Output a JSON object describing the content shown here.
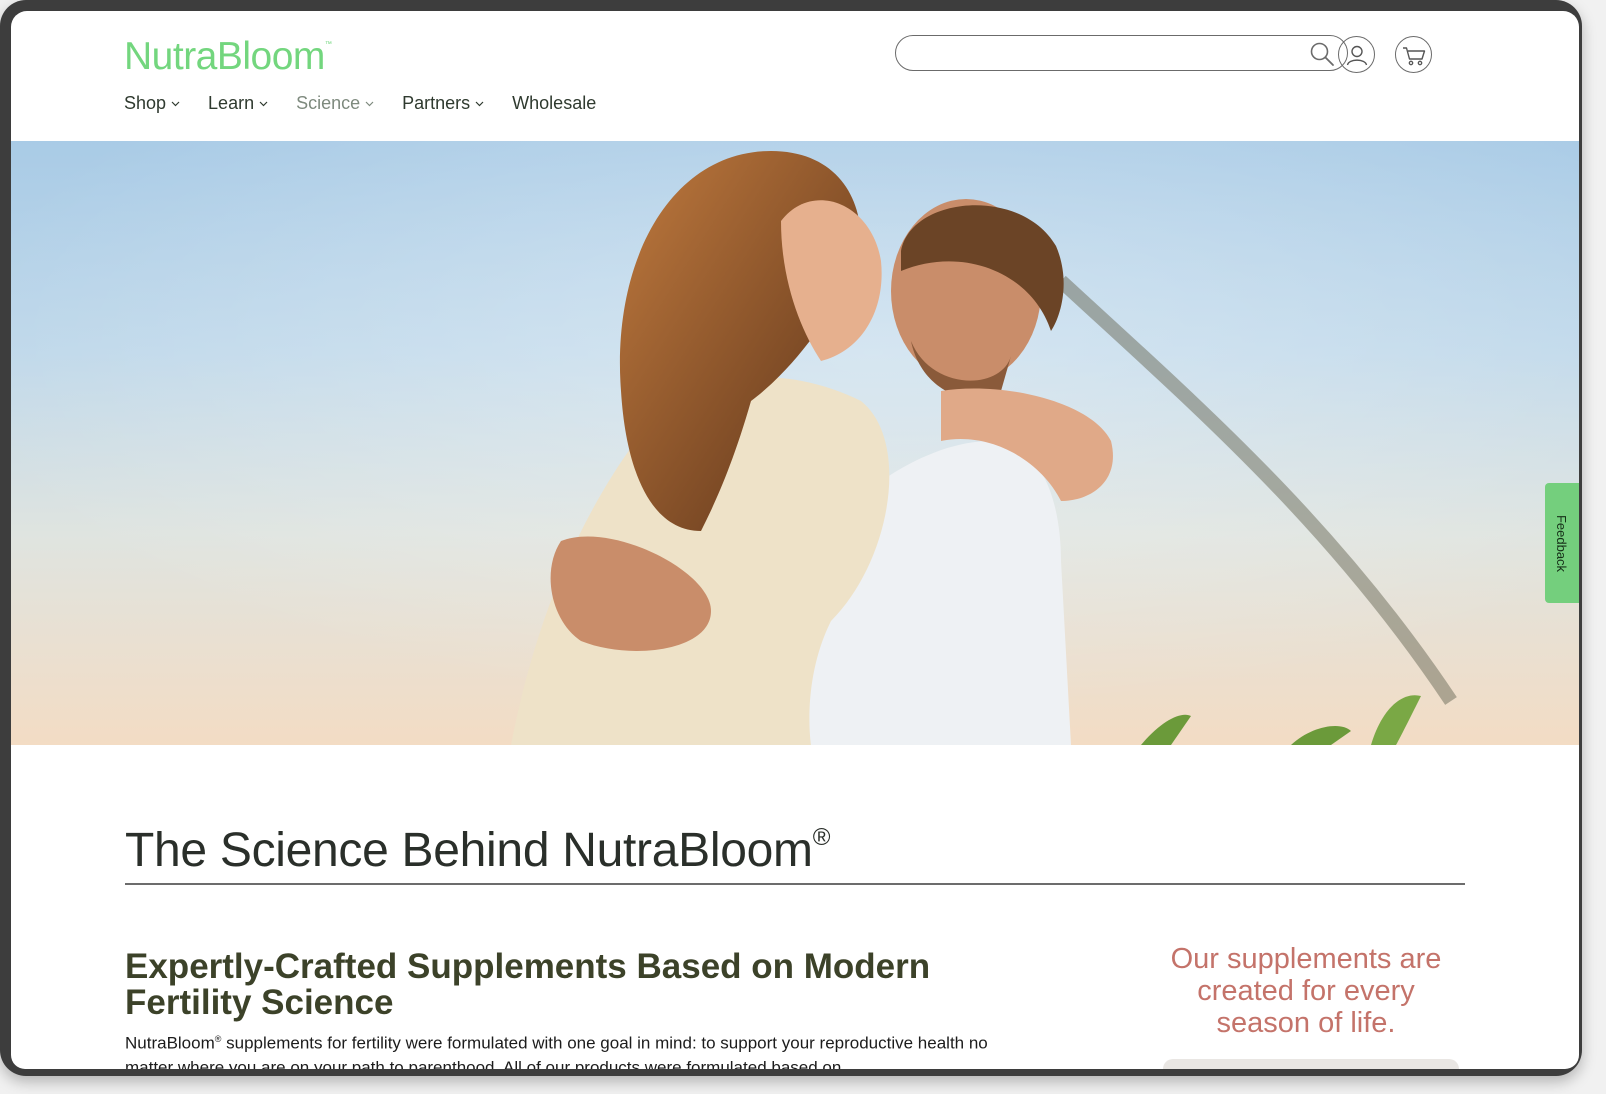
{
  "header": {
    "logo": "NutraBloom",
    "logo_tm": "™",
    "search": {
      "placeholder": ""
    },
    "icons": {
      "search": "search-icon",
      "account": "user-icon",
      "cart": "cart-icon"
    }
  },
  "nav": {
    "items": [
      {
        "label": "Shop",
        "has_dropdown": true
      },
      {
        "label": "Learn",
        "has_dropdown": true
      },
      {
        "label": "Science",
        "has_dropdown": true,
        "active": true
      },
      {
        "label": "Partners",
        "has_dropdown": true
      },
      {
        "label": "Wholesale",
        "has_dropdown": false
      }
    ]
  },
  "hero": {
    "image": "couple-embracing-photo"
  },
  "feedback": {
    "label": "Feedback"
  },
  "main": {
    "title": "The Science Behind NutraBloom",
    "title_reg": "®",
    "subheading": "Expertly-Crafted Supplements Based on Modern Fertility Science",
    "body_brand": "NutraBloom",
    "body_reg": "®",
    "body": " supplements for fertility were formulated with one goal in mind: to support your reproductive health no matter where you are on your path to parenthood. All of our products were formulated based on",
    "callout": "Our supplements are created for every season of life."
  },
  "colors": {
    "brand_green": "#73d67e",
    "nav_text": "#2f3a2f",
    "subhead": "#3c4229",
    "callout": "#c4736a",
    "feedback_tab": "#74cf7d"
  }
}
